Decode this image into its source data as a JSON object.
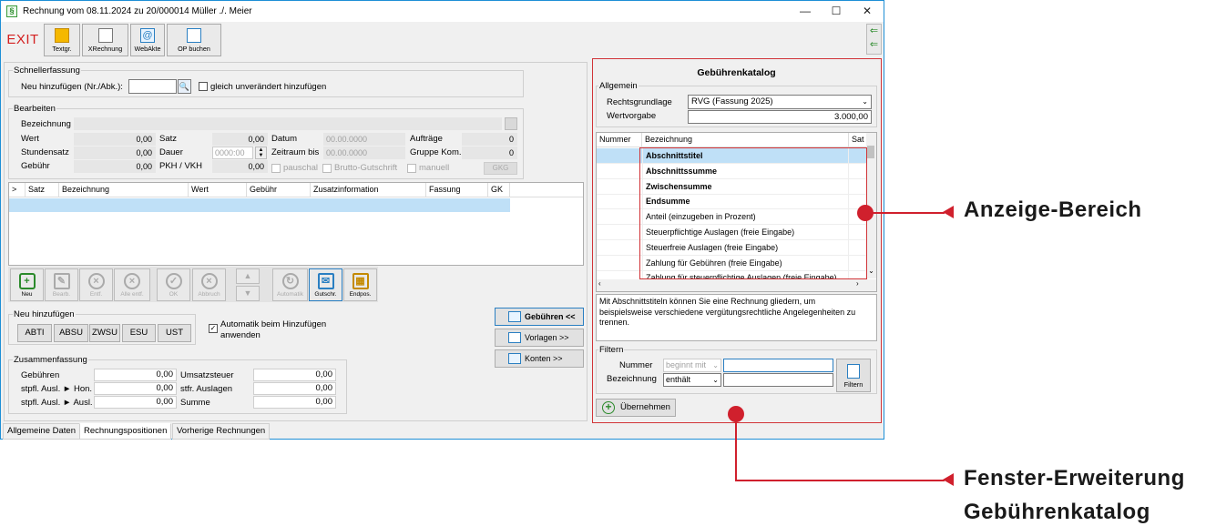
{
  "window": {
    "title": "Rechnung vom 08.11.2024 zu 20/000014  Müller ./. Meier",
    "title_icon": "§",
    "controls": {
      "minimize": "—",
      "maximize": "☐",
      "close": "✕"
    }
  },
  "toolbar": {
    "exit": "EXIT",
    "buttons": [
      {
        "label": "Textgr.",
        "icon": "textgroup-icon"
      },
      {
        "label": "XRechnung",
        "icon": "xrechnung-icon"
      },
      {
        "label": "WebAkte",
        "icon": "webakte-icon"
      },
      {
        "label": "OP buchen",
        "icon": "op-buchen-icon"
      }
    ]
  },
  "schnellerfassung": {
    "title": "Schnellerfassung",
    "label": "Neu hinzufügen (Nr./Abk.):",
    "value": "",
    "checkbox_label": "gleich unverändert hinzufügen",
    "checked": false
  },
  "bearbeiten": {
    "title": "Bearbeiten",
    "bezeichnung_label": "Bezeichnung",
    "wert_label": "Wert",
    "wert": "0,00",
    "stundensatz_label": "Stundensatz",
    "stundensatz": "0,00",
    "gebuehr_label": "Gebühr",
    "gebuehr": "0,00",
    "satz_label": "Satz",
    "satz": "0,00",
    "dauer_label": "Dauer",
    "dauer": "0000:00",
    "pkh_label": "PKH / VKH",
    "pkh": "0,00",
    "datum_label": "Datum",
    "datum": "00.00.0000",
    "zeitraum_label": "Zeitraum bis",
    "zeitraum": "00.00.0000",
    "pauschal_label": "pauschal",
    "brutto_label": "Brutto-Gutschrift",
    "auftraege_label": "Aufträge",
    "auftraege": "0",
    "gruppe_label": "Gruppe Kom.",
    "gruppe": "0",
    "manuell_label": "manuell",
    "gkg_label": "GKG"
  },
  "positions_table": {
    "columns": [
      ">",
      "Satz",
      "Bezeichnung",
      "Wert",
      "Gebühr",
      "Zusatzinformation",
      "Fassung",
      "GK"
    ]
  },
  "action_buttons": [
    {
      "label": "Neu",
      "icon": "plus-icon",
      "enabled": true
    },
    {
      "label": "Bearb.",
      "icon": "pencil-icon",
      "enabled": false
    },
    {
      "label": "Entf.",
      "icon": "delete-icon",
      "enabled": false
    },
    {
      "label": "Alle entf.",
      "icon": "delete-all-icon",
      "enabled": false
    },
    {
      "label": "OK",
      "icon": "check-icon",
      "enabled": false
    },
    {
      "label": "Abbruch",
      "icon": "cancel-icon",
      "enabled": false
    },
    {
      "label": "Automatik",
      "icon": "refresh-icon",
      "enabled": false
    },
    {
      "label": "Gutschr.",
      "icon": "credit-icon",
      "enabled": true
    },
    {
      "label": "Endpos.",
      "icon": "endpos-icon",
      "enabled": true
    }
  ],
  "neu_hinzufuegen": {
    "title": "Neu hinzufügen",
    "buttons": [
      "ABTI",
      "ABSU",
      "ZWSU",
      "ESU",
      "UST"
    ],
    "auto_label_1": "Automatik beim Hinzufügen",
    "auto_label_2": "anwenden",
    "auto_checked": true
  },
  "side_buttons": {
    "gebuehren": "Gebühren <<",
    "vorlagen": "Vorlagen >>",
    "konten": "Konten >>"
  },
  "zusammenfassung": {
    "title": "Zusammenfassung",
    "rows": [
      {
        "label": "Gebühren",
        "value": "0,00",
        "label2": "Umsatzsteuer",
        "value2": "0,00"
      },
      {
        "label": "stpfl. Ausl. ► Hon.",
        "value": "0,00",
        "label2": "stfr. Auslagen",
        "value2": "0,00"
      },
      {
        "label": "stpfl. Ausl. ► Ausl.",
        "value": "0,00",
        "label2": "Summe",
        "value2": "0,00"
      }
    ]
  },
  "tabs": [
    "Allgemeine Daten",
    "Rechnungspositionen",
    "Vorherige Rechnungen"
  ],
  "katalog": {
    "title": "Gebührenkatalog",
    "allgemein": "Allgemein",
    "rechtsgrundlage_label": "Rechtsgrundlage",
    "rechtsgrundlage": "RVG (Fassung 2025)",
    "wertvorgabe_label": "Wertvorgabe",
    "wertvorgabe": "3.000,00",
    "columns": [
      "Nummer",
      "Bezeichnung",
      "Sat"
    ],
    "items": [
      {
        "text": "Abschnittstitel",
        "bold": true
      },
      {
        "text": "Abschnittssumme",
        "bold": true
      },
      {
        "text": "Zwischensumme",
        "bold": true
      },
      {
        "text": "Endsumme",
        "bold": true
      },
      {
        "text": "Anteil (einzugeben in Prozent)",
        "bold": false
      },
      {
        "text": "Steuerpflichtige Auslagen (freie Eingabe)",
        "bold": false
      },
      {
        "text": "Steuerfreie Auslagen (freie Eingabe)",
        "bold": false
      },
      {
        "text": "Zahlung für Gebühren (freie Eingabe)",
        "bold": false
      },
      {
        "text": "Zahlung für steuerpflichtige Auslagen (freie Eingabe)",
        "bold": false
      }
    ],
    "description": "Mit Abschnittstiteln können Sie eine Rechnung gliedern, um beispielsweise verschiedene vergütungsrechtliche Angelegenheiten zu trennen.",
    "filtern": "Filtern",
    "nummer_label": "Nummer",
    "nummer_mode": "beginnt mit",
    "bezeichnung_label": "Bezeichnung",
    "bezeichnung_mode": "enthält",
    "filter_button": "Filtern",
    "uebernehmen": "Übernehmen"
  },
  "callouts": {
    "anzeige": "Anzeige-Bereich",
    "fenster_1": "Fenster-Erweiterung",
    "fenster_2": "Gebührenkatalog"
  },
  "colors": {
    "accent_red": "#d0202d",
    "selection": "#bfe0f7",
    "exit_red": "#d32020"
  }
}
